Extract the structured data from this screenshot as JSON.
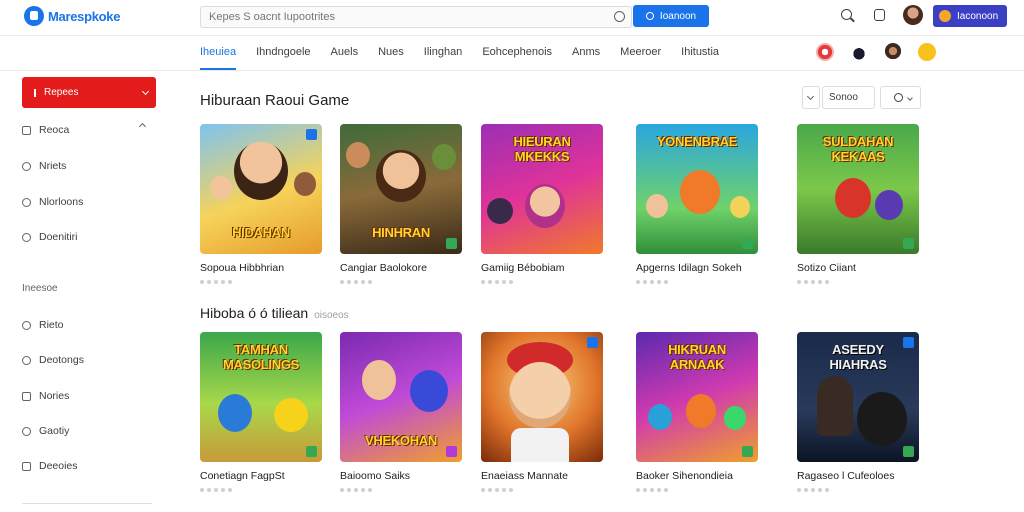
{
  "header": {
    "logo_text": "Marespkoke",
    "search_placeholder": "Kepes S oacnt Iupootrites",
    "search_button_label": "Ioanoon",
    "account_label": "Iaconoon"
  },
  "nav": {
    "tabs": [
      {
        "label": "Iheuiea",
        "active": true
      },
      {
        "label": "Ihndngoele",
        "active": false
      },
      {
        "label": "Auels",
        "active": false
      },
      {
        "label": "Nues",
        "active": false
      },
      {
        "label": "Ilinghan",
        "active": false
      },
      {
        "label": "Eohcephenois",
        "active": false
      },
      {
        "label": "Anms",
        "active": false
      },
      {
        "label": "Meeroer",
        "active": false
      },
      {
        "label": "Ihitustia",
        "active": false
      }
    ],
    "icons": [
      "alert-icon",
      "drop-icon",
      "user-icon",
      "coin-icon"
    ]
  },
  "sidebar": {
    "primary_label": "Repees",
    "items": [
      {
        "label": "Reoca",
        "icon": "square-icon"
      },
      {
        "label": "Nriets",
        "icon": "tag-icon"
      },
      {
        "label": "Nlorloons",
        "icon": "tag-icon"
      },
      {
        "label": "Doenitiri",
        "icon": "person-icon"
      }
    ],
    "section_heading": "Ineesoe",
    "section_items": [
      {
        "label": "Rieto",
        "icon": "tag-icon"
      },
      {
        "label": "Deotongs",
        "icon": "tag-icon"
      },
      {
        "label": "Nories",
        "icon": "square-icon"
      },
      {
        "label": "Gaotiy",
        "icon": "tag-icon"
      },
      {
        "label": "Deeoies",
        "icon": "doc-icon"
      }
    ]
  },
  "main": {
    "section1_title": "Hiburaan Raoui Game",
    "section2_title": "Hiboba ó ó tiliean",
    "section2_sub": "oisoeos",
    "sort_label": "Sonoo",
    "row1": [
      {
        "name": "Sopoua Hibbhrian",
        "art": "HIDAHAN"
      },
      {
        "name": "Cangiar Baolokore",
        "art": "HINHRAN"
      },
      {
        "name": "Gamiig Bébobiam",
        "art": "HIEURAN MKEKKS"
      },
      {
        "name": "Apgerns Idilagn Sokeh",
        "art": "YONENBRAE"
      },
      {
        "name": "Sotizo Ciiant",
        "art": "SULDAHAN KEKAAS"
      }
    ],
    "row2": [
      {
        "name": "Conetiagn FagpSt",
        "art": "TAMHAN MASOLINGS"
      },
      {
        "name": "Baioomo Saiks",
        "art": "VHEKOHAN"
      },
      {
        "name": "Enaeiass Mannate",
        "art": ""
      },
      {
        "name": "Baoker Sihenondieia",
        "art": "HIKRUAN ARNAAK"
      },
      {
        "name": "Ragaseo l Cufeoloes",
        "art": "ASEEDY HIAHRAS"
      }
    ]
  },
  "colors": {
    "brand_blue": "#1a73e8",
    "primary_red": "#e31b1b",
    "account_purple": "#3b3fc4"
  }
}
